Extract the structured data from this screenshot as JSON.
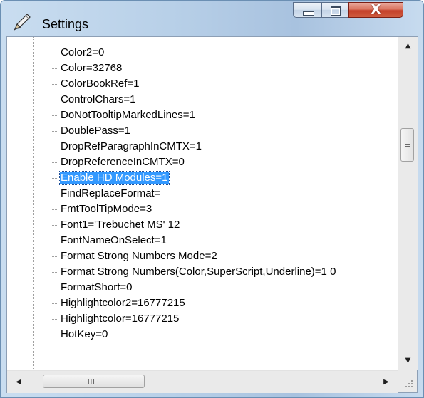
{
  "window": {
    "title": "Settings",
    "icon": "pencil-icon"
  },
  "caption_buttons": {
    "close_label": "X"
  },
  "tree": {
    "items": [
      {
        "label": "Color2=0"
      },
      {
        "label": "Color=32768"
      },
      {
        "label": "ColorBookRef=1"
      },
      {
        "label": "ControlChars=1"
      },
      {
        "label": "DoNotTooltipMarkedLines=1"
      },
      {
        "label": "DoublePass=1"
      },
      {
        "label": "DropRefParagraphInCMTX=1"
      },
      {
        "label": "DropReferenceInCMTX=0"
      },
      {
        "label": "Enable HD Modules=1",
        "selected": true
      },
      {
        "label": "FindReplaceFormat="
      },
      {
        "label": "FmtToolTipMode=3"
      },
      {
        "label": "Font1='Trebuchet MS' 12"
      },
      {
        "label": "FontNameOnSelect=1"
      },
      {
        "label": "Format Strong Numbers Mode=2"
      },
      {
        "label": "Format Strong Numbers(Color,SuperScript,Underline)=1 0"
      },
      {
        "label": "FormatShort=0"
      },
      {
        "label": "Highlightcolor2=16777215"
      },
      {
        "label": "Highlightcolor=16777215"
      },
      {
        "label": "HotKey=0"
      }
    ]
  },
  "colors": {
    "selection": "#3399ff",
    "selection_text": "#ffffff"
  },
  "hscroll": {
    "thumb_grip": "III"
  }
}
